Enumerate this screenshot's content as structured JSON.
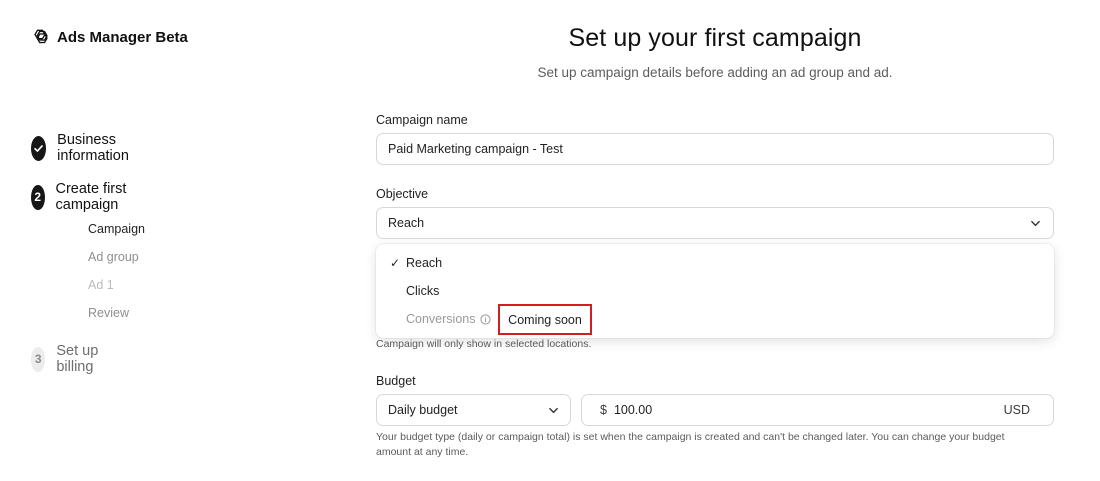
{
  "app": {
    "title": "Ads Manager Beta"
  },
  "steps": [
    {
      "number": "",
      "label": "Business information",
      "state": "done"
    },
    {
      "number": "2",
      "label": "Create first campaign",
      "state": "active"
    },
    {
      "number": "3",
      "label": "Set up billing",
      "state": "pending"
    }
  ],
  "substeps": [
    "Campaign",
    "Ad group",
    "Ad 1",
    "Review"
  ],
  "main": {
    "title": "Set up your first campaign",
    "subtitle": "Set up campaign details before adding an ad group and ad."
  },
  "campaign_name": {
    "label": "Campaign name",
    "value": "Paid Marketing campaign - Test"
  },
  "objective": {
    "label": "Objective",
    "selected": "Reach",
    "options": [
      {
        "label": "Reach",
        "checked": true
      },
      {
        "label": "Clicks"
      },
      {
        "label": "Conversions",
        "disabled": true,
        "badge": "Coming soon"
      }
    ]
  },
  "location_helper": "Campaign will only show in selected locations.",
  "budget": {
    "label": "Budget",
    "type": "Daily budget",
    "currency_symbol": "$",
    "amount": "100.00",
    "currency": "USD",
    "helper_line1": "Your budget type (daily or campaign total) is set when the campaign is created and can't be changed later. You can change your budget",
    "helper_line2": "amount at any time."
  },
  "colors": {
    "highlight": "#d21d24",
    "stepper_dark": "#161616"
  }
}
